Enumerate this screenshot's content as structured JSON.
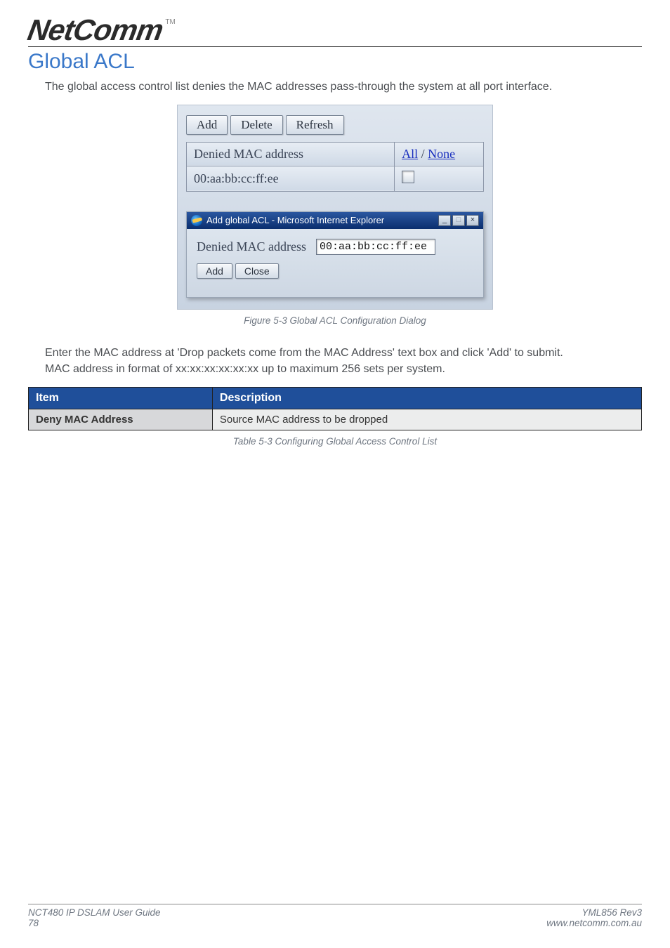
{
  "logo": {
    "text": "NetComm",
    "tm": "TM"
  },
  "h1": "Global ACL",
  "intro": "The global access control list denies the MAC addresses pass-through the system at all port interface.",
  "screenshot": {
    "buttons": {
      "add": "Add",
      "del": "Delete",
      "refresh": "Refresh"
    },
    "table": {
      "header_left": "Denied MAC address",
      "header_right_all": "All",
      "header_right_sep": " / ",
      "header_right_none": "None",
      "row_mac": "00:aa:bb:cc:ff:ee"
    },
    "popup": {
      "title": "Add global ACL - Microsoft Internet Explorer",
      "label": "Denied MAC address",
      "value": "00:aa:bb:cc:ff:ee",
      "add": "Add",
      "close": "Close"
    }
  },
  "fig_caption": "Figure 5-3 Global ACL Configuration Dialog",
  "para2a": "Enter the MAC address at 'Drop packets come from the MAC Address' text box and click 'Add' to submit.",
  "para2b": "MAC address in format of xx:xx:xx:xx:xx:xx up to maximum 256 sets per system.",
  "dtable": {
    "h_item": "Item",
    "h_desc": "Description",
    "r1k": "Deny MAC Address",
    "r1v": "Source MAC address to be dropped"
  },
  "tbl_caption": "Table 5-3 Configuring Global Access Control List",
  "footer": {
    "left1": "NCT480 IP DSLAM User Guide",
    "left2": "78",
    "right1": "YML856 Rev3",
    "right2": "www.netcomm.com.au"
  }
}
